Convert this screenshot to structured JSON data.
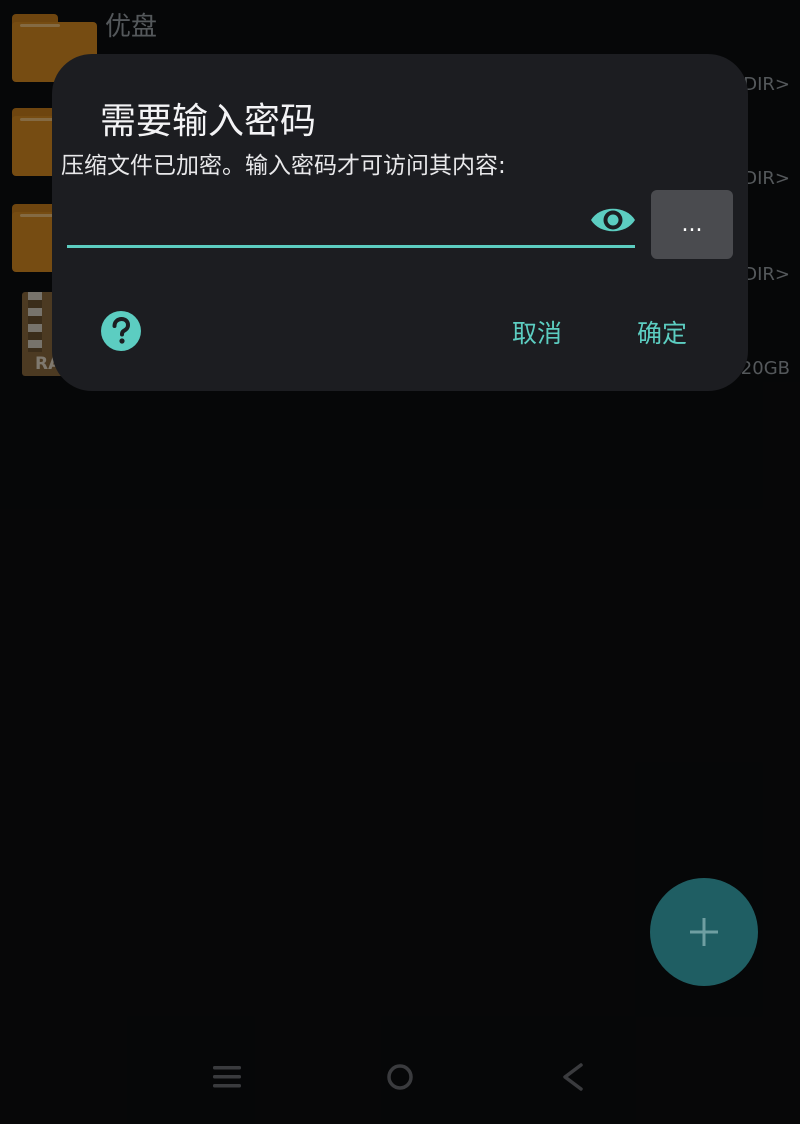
{
  "background_list": {
    "rows": [
      {
        "name": "优盘",
        "meta": "DIR>"
      },
      {
        "name": "",
        "meta": "DIR>"
      },
      {
        "name": "",
        "meta": "DIR>"
      },
      {
        "archive_label": "RA",
        "meta": "20GB"
      }
    ]
  },
  "dialog": {
    "title": "需要输入密码",
    "message": "压缩文件已加密。输入密码才可访问其内容:",
    "password_value": "",
    "more_label": "...",
    "cancel_label": "取消",
    "ok_label": "确定"
  },
  "colors": {
    "accent": "#5ccdc1",
    "dialog_bg": "#1c1d21",
    "page_bg": "#0c0d0f",
    "folder": "#d88a22",
    "fab": "#1f5e63"
  },
  "icons": {
    "eye": "eye-icon",
    "help": "help-icon",
    "add": "plus-icon",
    "nav_menu": "menu-icon",
    "nav_home": "home-icon",
    "nav_back": "back-icon"
  }
}
